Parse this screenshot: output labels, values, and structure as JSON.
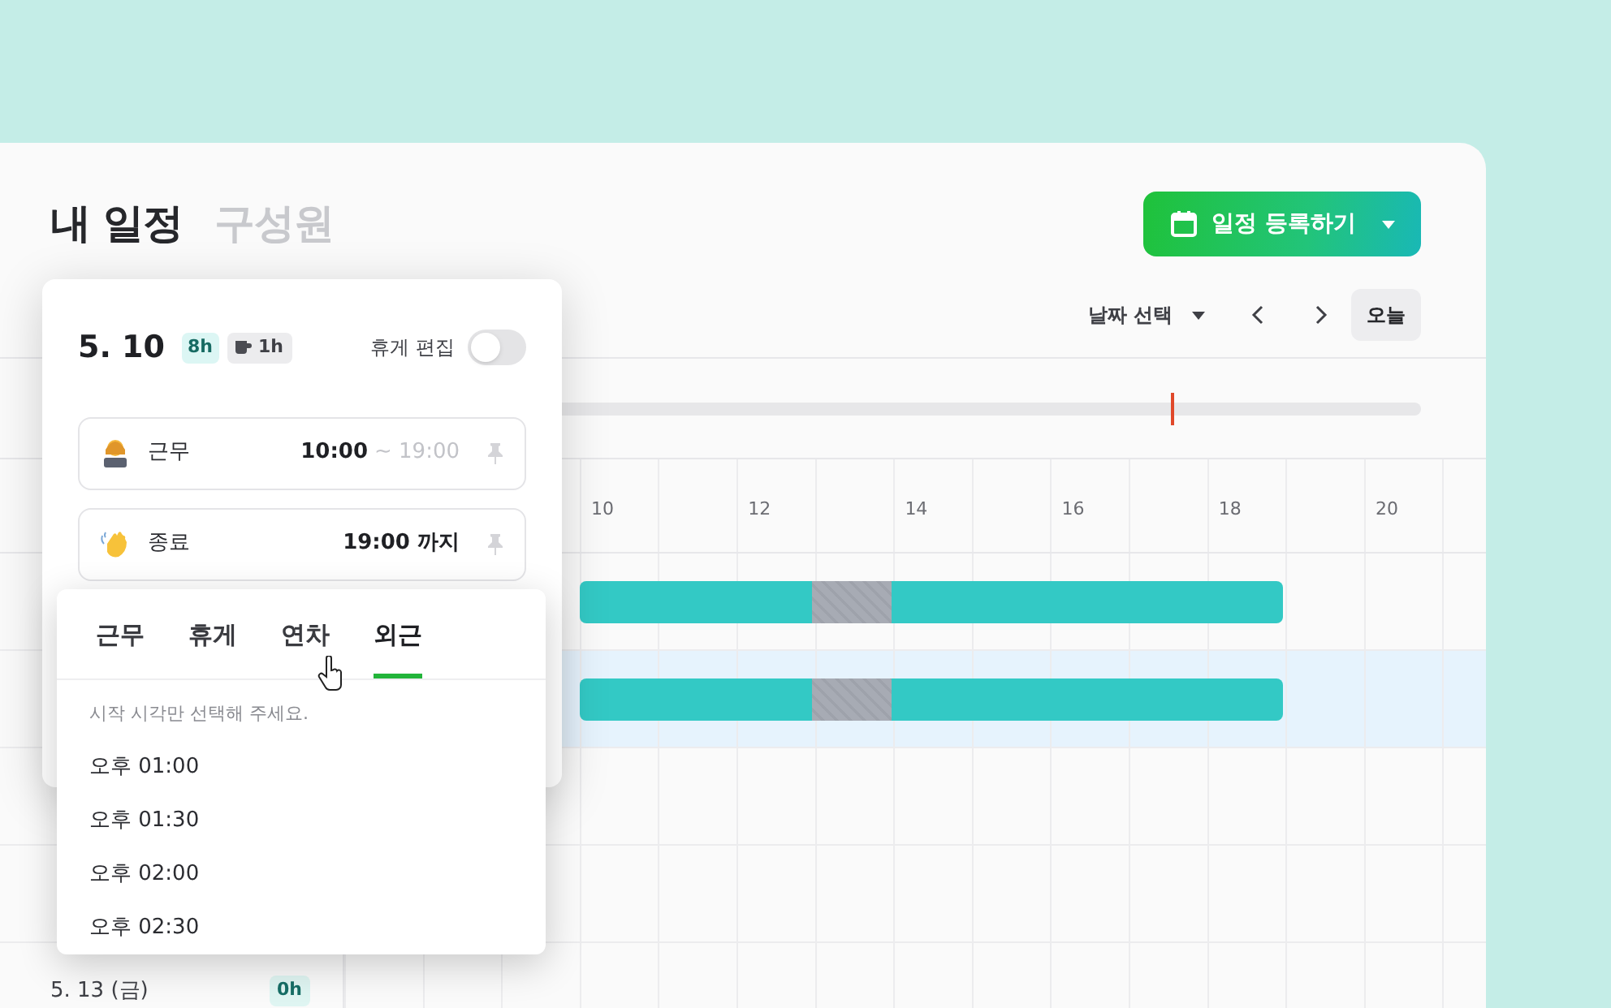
{
  "header": {
    "tabs": [
      {
        "label": "내 일정",
        "selected": true
      },
      {
        "label": "구성원",
        "selected": false
      }
    ],
    "register_button": "일정 등록하기"
  },
  "toolbar": {
    "date_select": "날짜 선택",
    "today_button": "오늘"
  },
  "timeline": {
    "now_marker": {
      "level": 0.76
    },
    "hours": [
      "10",
      "12",
      "14",
      "16",
      "18",
      "20"
    ]
  },
  "rows": [
    {
      "selected": false,
      "kind": "work"
    },
    {
      "selected": true,
      "kind": "work"
    },
    {
      "selected": false,
      "kind": "empty"
    },
    {
      "selected": false,
      "kind": "empty"
    },
    {
      "date": "5. 13 (금)",
      "hours_badge": "0h",
      "selected": false,
      "kind": "empty"
    }
  ],
  "day_card": {
    "date": "5. 10",
    "work_hours": "8h",
    "break_hours": "1h",
    "break_edit": {
      "label": "휴게 편집",
      "on": false
    },
    "entries": [
      {
        "kind": "work",
        "label": "근무",
        "time": "10:00",
        "end": "~ 19:00"
      },
      {
        "kind": "leave",
        "label": "종료",
        "time": "19:00 까지"
      }
    ]
  },
  "type_menu": {
    "tabs": [
      {
        "label": "근무",
        "selected": false
      },
      {
        "label": "휴게",
        "selected": false
      },
      {
        "label": "연차",
        "selected": false
      },
      {
        "label": "외근",
        "selected": true
      }
    ],
    "hint": "시작 시각만 선택해 주세요.",
    "options": [
      "오후 01:00",
      "오후 01:30",
      "오후 02:00",
      "오후 02:30"
    ]
  }
}
